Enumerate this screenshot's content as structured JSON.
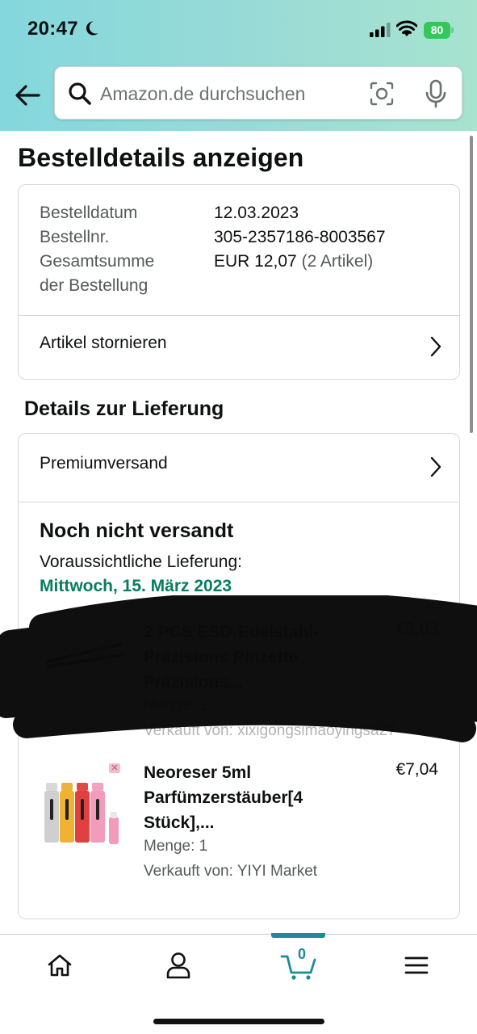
{
  "status_bar": {
    "time": "20:47",
    "battery": "80"
  },
  "search": {
    "placeholder": "Amazon.de durchsuchen"
  },
  "page": {
    "title": "Bestelldetails anzeigen"
  },
  "order_summary": {
    "date_label": "Bestelldatum",
    "date_value": "12.03.2023",
    "number_label": "Bestellnr.",
    "number_value": "305-2357186-8003567",
    "total_label_line1": "Gesamtsumme",
    "total_label_line2": "der Bestellung",
    "total_value": "EUR 12,07",
    "total_items": "(2 Artikel)",
    "cancel_label": "Artikel stornieren"
  },
  "delivery": {
    "section_title": "Details zur Lieferung",
    "shipping_method": "Premiumversand",
    "status": "Noch nicht versandt",
    "estimated_label": "Voraussichtliche Lieferung:",
    "estimated_date": "Mittwoch, 15. März 2023",
    "accent_color": "#067d62"
  },
  "items": [
    {
      "title": "2 PCS ESD-Edelstahl-Präzisions Pinzette Präzisions...",
      "price": "€5,03",
      "quantity": "Menge: 1",
      "seller": "Verkauft von: xixigongsimaoyingsa27",
      "redacted": true
    },
    {
      "title": "Neoreser 5ml Parfümzerstäuber[4 Stück],...",
      "price": "€7,04",
      "quantity": "Menge: 1",
      "seller": "Verkauft von: YIYI Market",
      "redacted": false
    }
  ],
  "bottom_nav": {
    "items": [
      "home-icon",
      "account-icon",
      "cart-icon",
      "menu-icon"
    ],
    "cart_count": "0",
    "active": "cart",
    "active_color": "#1b8a9a"
  }
}
